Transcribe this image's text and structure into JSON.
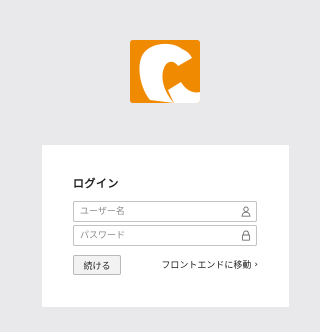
{
  "app": {
    "logo_icon": "concrete-c-logo",
    "brand_color": "#f08a00"
  },
  "login": {
    "title": "ログイン",
    "username": {
      "placeholder": "ユーザー名",
      "value": "",
      "icon": "user-icon"
    },
    "password": {
      "placeholder": "パスワード",
      "value": "",
      "icon": "lock-icon"
    },
    "submit_label": "続ける",
    "frontend_link_label": "フロントエンドに移動",
    "frontend_link_chevron": "›"
  }
}
